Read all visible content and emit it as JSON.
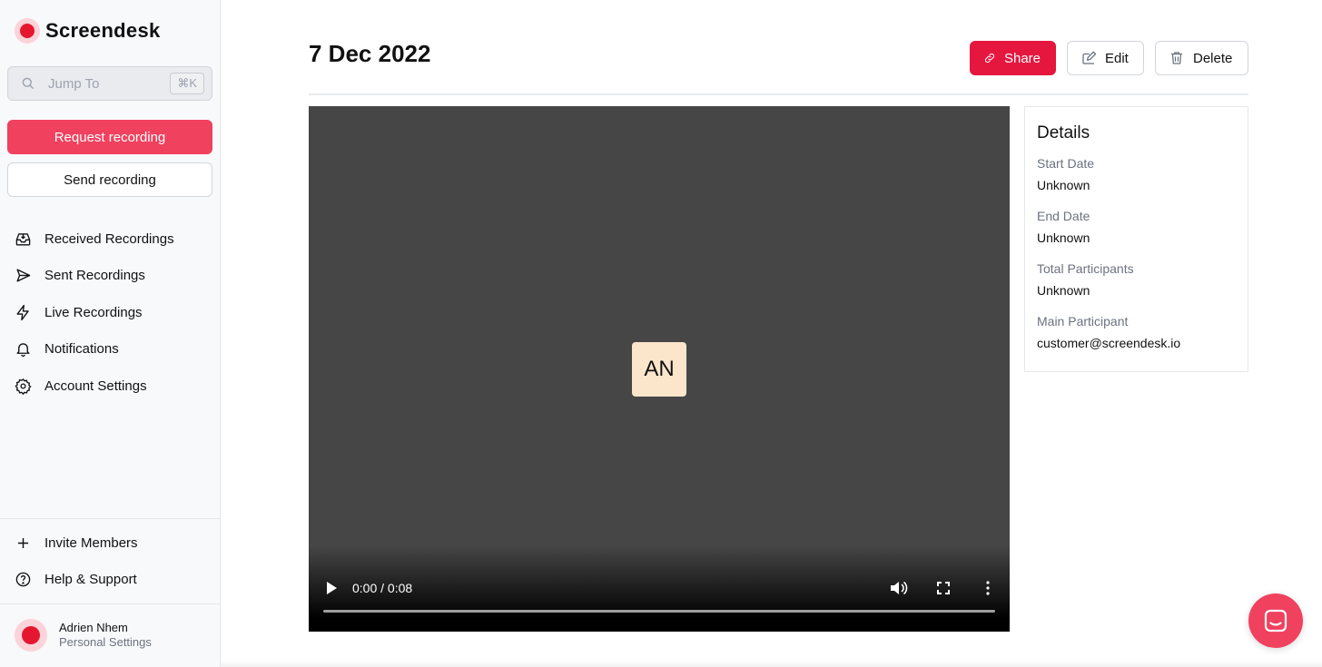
{
  "app": {
    "name": "Screendesk"
  },
  "search": {
    "placeholder": "Jump To",
    "shortcut": "⌘K"
  },
  "sidebar": {
    "request_label": "Request recording",
    "send_label": "Send recording",
    "items": [
      {
        "label": "Received Recordings",
        "icon": "inbox-icon"
      },
      {
        "label": "Sent Recordings",
        "icon": "send-icon"
      },
      {
        "label": "Live Recordings",
        "icon": "lightning-icon"
      },
      {
        "label": "Notifications",
        "icon": "bell-icon"
      },
      {
        "label": "Account Settings",
        "icon": "gear-icon"
      }
    ],
    "bottom_items": [
      {
        "label": "Invite Members",
        "icon": "plus-icon"
      },
      {
        "label": "Help & Support",
        "icon": "help-circle-icon"
      }
    ],
    "user": {
      "name": "Adrien Nhem",
      "subtitle": "Personal Settings"
    }
  },
  "page": {
    "title": "7 Dec 2022",
    "actions": {
      "share": "Share",
      "edit": "Edit",
      "delete": "Delete"
    }
  },
  "video": {
    "initials": "AN",
    "time": "0:00 / 0:08",
    "progress": 0
  },
  "details": {
    "heading": "Details",
    "fields": [
      {
        "label": "Start Date",
        "value": "Unknown"
      },
      {
        "label": "End Date",
        "value": "Unknown"
      },
      {
        "label": "Total Participants",
        "value": "Unknown"
      },
      {
        "label": "Main Participant",
        "value": "customer@screendesk.io"
      }
    ]
  },
  "colors": {
    "brand_red": "#e5172f",
    "primary_button": "#f0415e",
    "share_button": "#e5173f",
    "video_bg": "#464646",
    "avatar_bg": "#fbe6cc"
  }
}
